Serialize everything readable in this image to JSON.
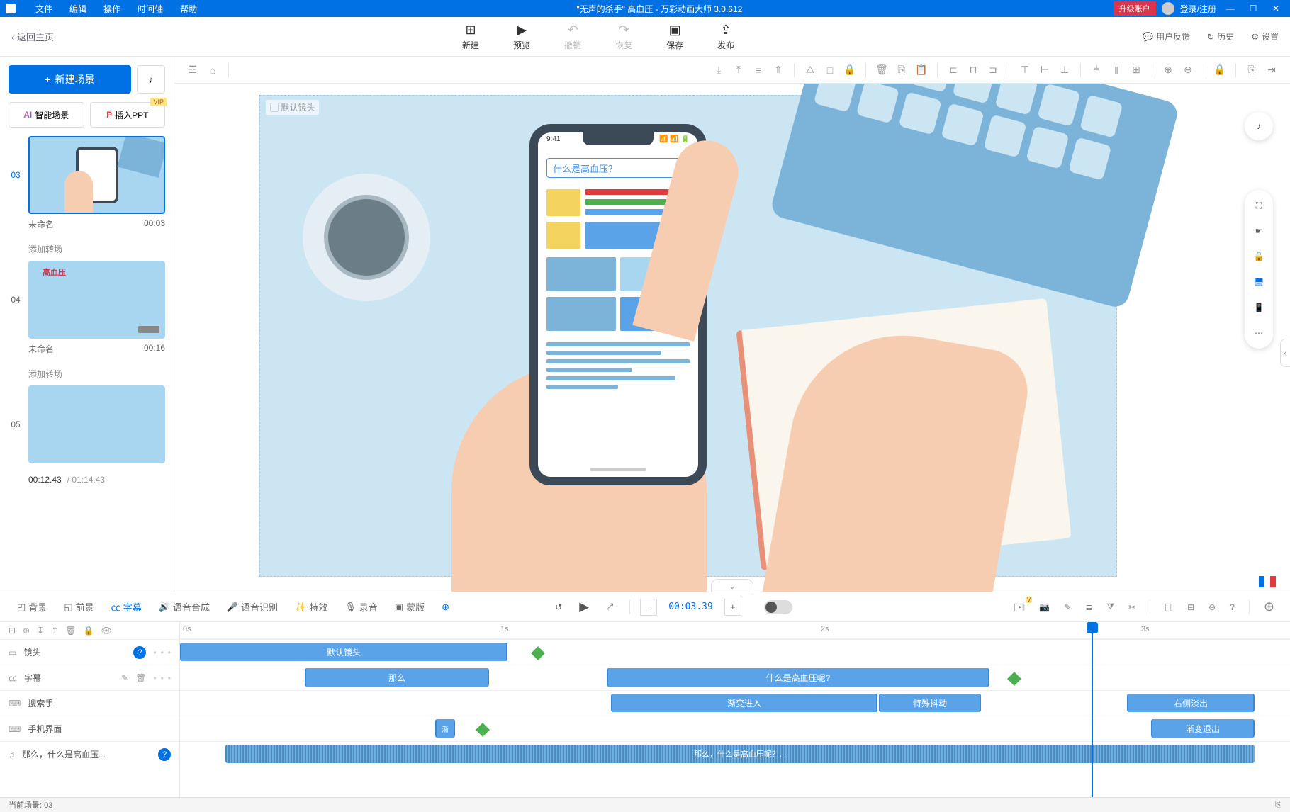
{
  "titlebar": {
    "menus": [
      "文件",
      "编辑",
      "操作",
      "时间轴",
      "帮助"
    ],
    "title": "\"无声的杀手\" 高血压 - 万彩动画大师 3.0.612",
    "upgrade": "升级账户",
    "login": "登录/注册"
  },
  "top_toolbar": {
    "back": "‹ 返回主页",
    "new": "新建",
    "preview": "预览",
    "undo": "撤销",
    "redo": "恢复",
    "save": "保存",
    "publish": "发布",
    "feedback": "用户反馈",
    "history": "历史",
    "settings": "设置"
  },
  "sidebar": {
    "new_scene": "新建场景",
    "smart_scene": "智能场景",
    "insert_ppt": "插入PPT",
    "vip": "VIP",
    "scenes": [
      {
        "num": "03",
        "name": "未命名",
        "time": "00:03",
        "active": true
      },
      {
        "num": "04",
        "name": "未命名",
        "time": "00:16",
        "active": false,
        "thumb_text": "高血压"
      },
      {
        "num": "05",
        "name": "",
        "time": "",
        "active": false
      }
    ],
    "add_transition": "添加转场",
    "current_time": "00:12.43",
    "total_time": "/ 01:14.43"
  },
  "canvas": {
    "scene_tag": "▢ 默认镜头",
    "phone_time": "9:41",
    "phone_status": "📶 📶 🔋",
    "phone_search": "什么是高血压？"
  },
  "bottom": {
    "tabs": {
      "background": "背景",
      "foreground": "前景",
      "subtitle": "字幕",
      "tts": "语音合成",
      "asr": "语音识别",
      "effect": "特效",
      "record": "录音",
      "mask": "蒙版"
    },
    "time_code": "00:03.39"
  },
  "timeline": {
    "ruler": {
      "t0": "0s",
      "t1": "1s",
      "t2": "2s",
      "t3": "3s"
    },
    "tracks": {
      "camera": "镜头",
      "subtitle": "字幕",
      "hand": "搜索手",
      "phone": "手机界面",
      "audio": "那么，什么是高血压..."
    },
    "clips": {
      "default_shot": "默认镜头",
      "sub1": "那么",
      "sub2": "什么是高血压呢?",
      "fadein": "渐变进入",
      "special": "特殊抖动",
      "fadeout_r": "右侧淡出",
      "grad": "渐",
      "fadeout": "渐变退出",
      "audio_label": "那么，什么是高血压呢？..."
    }
  },
  "statusbar": {
    "current_scene": "当前场景: 03"
  }
}
